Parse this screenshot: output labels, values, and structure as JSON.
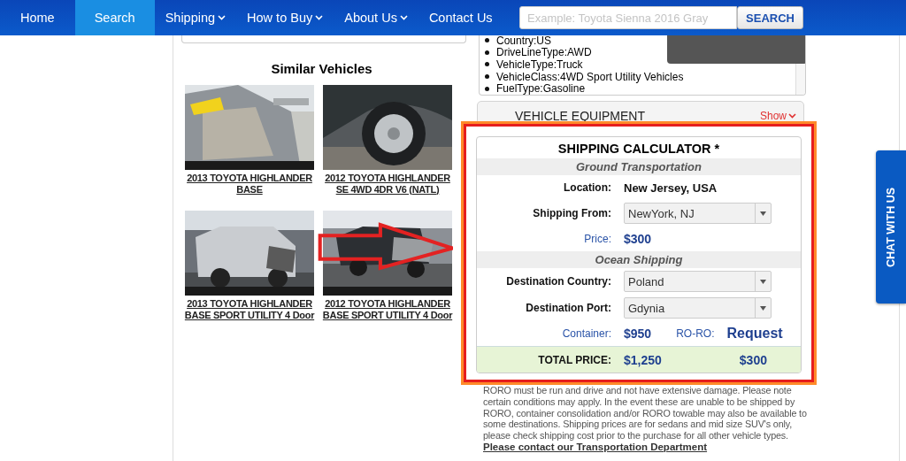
{
  "nav": {
    "items": [
      {
        "label": "Home",
        "selected": false,
        "dropdown": false
      },
      {
        "label": "Search",
        "selected": true,
        "dropdown": false
      },
      {
        "label": "Shipping",
        "selected": false,
        "dropdown": true
      },
      {
        "label": "How to Buy",
        "selected": false,
        "dropdown": true
      },
      {
        "label": "About Us",
        "selected": false,
        "dropdown": true
      },
      {
        "label": "Contact Us",
        "selected": false,
        "dropdown": false
      }
    ],
    "search": {
      "placeholder": "Example: Toyota Sienna 2016 Gray",
      "button": "SEARCH"
    }
  },
  "similar": {
    "title": "Similar Vehicles",
    "vehicles": [
      {
        "title": "2013 TOYOTA HIGHLANDER BASE",
        "kind": "picture"
      },
      {
        "title": "2012 TOYOTA HIGHLANDER SE 4WD 4DR V6 (NATL)",
        "kind": "picture"
      },
      {
        "title": "2013 TOYOTA HIGHLANDER BASE SPORT UTILITY 4 Door",
        "kind": "picture"
      },
      {
        "title": "2012 TOYOTA HIGHLANDER BASE SPORT UTILITY 4 Door",
        "kind": "picture"
      }
    ]
  },
  "specs": [
    "Country:US",
    "DriveLineType:AWD",
    "VehicleType:Truck",
    "VehicleClass:4WD Sport Utility Vehicles",
    "FuelType:Gasoline"
  ],
  "equipment": {
    "title": "VEHICLE EQUIPMENT",
    "toggle": "Show"
  },
  "calculator": {
    "title": "SHIPPING CALCULATOR *",
    "sections": [
      {
        "heading": "Ground Transportation",
        "rows": [
          {
            "kind": "text",
            "label": "Location:",
            "value": "New Jersey, USA"
          },
          {
            "kind": "select",
            "label": "Shipping From:",
            "value": "NewYork, NJ"
          },
          {
            "kind": "price",
            "label": "Price:",
            "value": "$300"
          }
        ]
      },
      {
        "heading": "Ocean Shipping",
        "rows": [
          {
            "kind": "select",
            "label": "Destination Country:",
            "value": "Poland"
          },
          {
            "kind": "select",
            "label": "Destination Port:",
            "value": "Gdynia"
          },
          {
            "kind": "pair",
            "label": "Container:",
            "value": "$950",
            "label2": "RO-RO:",
            "value2": "Request"
          }
        ]
      }
    ],
    "total": {
      "label": "TOTAL PRICE:",
      "value": "$1,250",
      "value2": "$300"
    }
  },
  "disclaimer": "RORO must be run and drive and not have extensive damage. Please note certain conditions may apply. In the event these are unable to be shipped by RORO, container consolidation and/or RORO towable may also be available to some destinations. Shipping prices are for sedans and mid size SUV's only, please check shipping cost prior to the purchase for all other vehicle types.",
  "contact_link": "Please contact our Transportation Department",
  "chat": "CHAT WITH US"
}
